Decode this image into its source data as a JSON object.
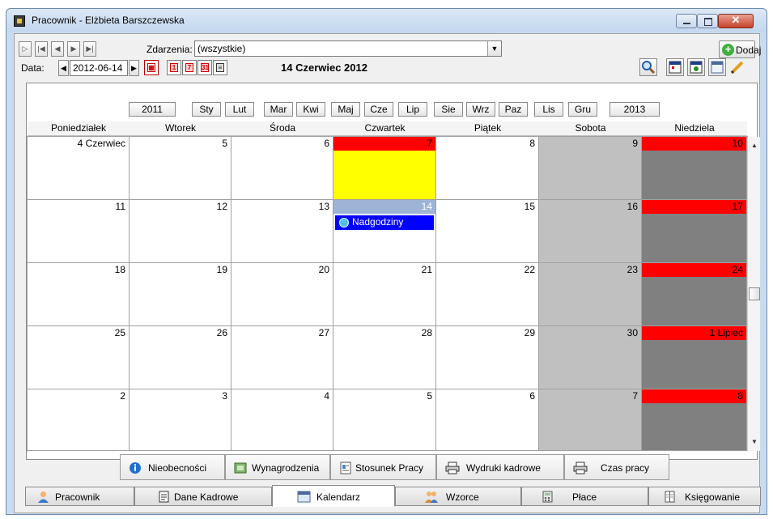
{
  "window": {
    "title": "Pracownik - Elżbieta Barszczewska",
    "close_glyph": "✕"
  },
  "toolbar": {
    "events_label": "Zdarzenia:",
    "events_value": "(wszystkie)",
    "add_label": "Dodaj",
    "date_label": "Data:",
    "date_value": "2012-06-14",
    "date_long": "14 Czerwiec 2012",
    "day_icon_text": "1",
    "week_icon_text": "7",
    "month_icon_text": "31"
  },
  "months": {
    "prev_year": "2011",
    "next_year": "2013",
    "items": [
      "Sty",
      "Lut",
      "Mar",
      "Kwi",
      "Maj",
      "Cze",
      "Lip",
      "Sie",
      "Wrz",
      "Paz",
      "Lis",
      "Gru"
    ]
  },
  "weekdays": [
    "Poniedziałek",
    "Wtorek",
    "Środa",
    "Czwartek",
    "Piątek",
    "Sobota",
    "Niedziela"
  ],
  "weeks": [
    [
      "4 Czerwiec",
      "5",
      "6",
      "7",
      "8",
      "9",
      "10"
    ],
    [
      "11",
      "12",
      "13",
      "14",
      "15",
      "16",
      "17"
    ],
    [
      "18",
      "19",
      "20",
      "21",
      "22",
      "23",
      "24"
    ],
    [
      "25",
      "26",
      "27",
      "28",
      "29",
      "30",
      "1 Lipiec"
    ],
    [
      "2",
      "3",
      "4",
      "5",
      "6",
      "7",
      "8"
    ]
  ],
  "event": {
    "label": "Nadgodziny"
  },
  "colors": {
    "weekend": "#c0c0c0",
    "sunday": "#808080",
    "holiday_header": "#ff0000",
    "holiday_body": "#ffff00",
    "selected_header": "#9eb4d6",
    "event": "#0000ff"
  },
  "bottom_buttons": [
    "Nieobecności",
    "Wynagrodzenia",
    "Stosunek Pracy",
    "Wydruki kadrowe",
    "Czas pracy"
  ],
  "tabs": [
    "Pracownik",
    "Dane Kadrowe",
    "Kalendarz",
    "Wzorce",
    "Płace",
    "Księgowanie"
  ]
}
